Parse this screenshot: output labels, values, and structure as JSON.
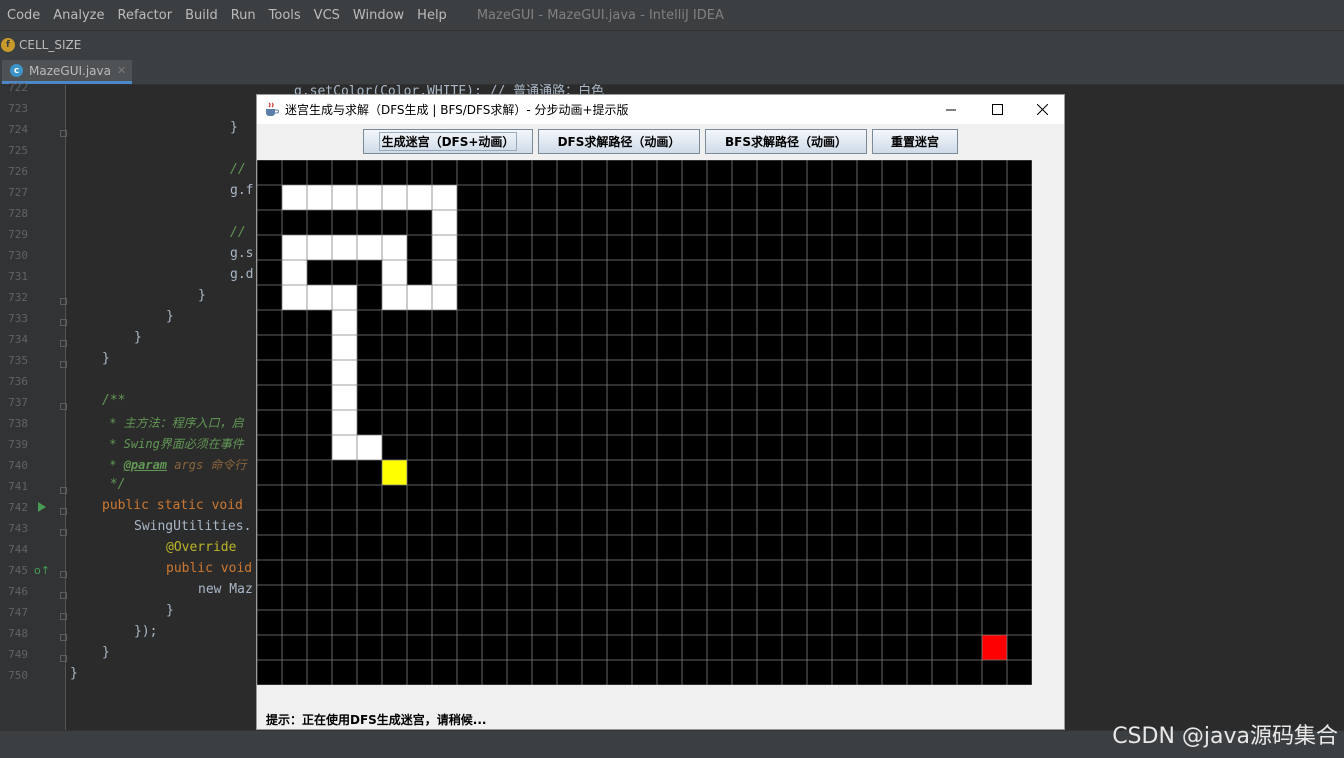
{
  "ide": {
    "menu": [
      "Code",
      "Analyze",
      "Refactor",
      "Build",
      "Run",
      "Tools",
      "VCS",
      "Window",
      "Help"
    ],
    "title": "MazeGUI - MazeGUI.java - IntelliJ IDEA",
    "breadcrumb": "CELL_SIZE",
    "tab_label": "MazeGUI.java",
    "line_numbers": [
      "722",
      "723",
      "724",
      "725",
      "726",
      "727",
      "728",
      "729",
      "730",
      "731",
      "732",
      "733",
      "734",
      "735",
      "736",
      "737",
      "738",
      "739",
      "740",
      "741",
      "742",
      "743",
      "744",
      "745",
      "746",
      "747",
      "748",
      "749",
      "750"
    ],
    "code_fragments": {
      "l722": "g.setColor(Color.WHITE); // 普通通路：白色",
      "l724": "}",
      "l726": "// ",
      "l727": "g.f",
      "l729": "// ",
      "l730": "g.s",
      "l731": "g.d",
      "l732": "}",
      "l733": "}",
      "l734": "}",
      "l735": "}",
      "l737": "/**",
      "l738": " * 主方法：程序入口，启",
      "l739": " * Swing界面必须在事件",
      "l740_tag": "@param",
      "l740_rest": " args 命令行",
      "l741": " */",
      "l742": "public static void",
      "l743": "SwingUtilities.",
      "l744": "@Override",
      "l745": "public void",
      "l746": "new Maz",
      "l747": "}",
      "l748": "});",
      "l749": "}",
      "l750": "}"
    },
    "watermark": "CSDN @java源码集合"
  },
  "window": {
    "title": "迷宫生成与求解（DFS生成 | BFS/DFS求解）- 分步动画+提示版",
    "buttons": {
      "generate": "生成迷宫（DFS+动画）",
      "dfs_solve": "DFS求解路径（动画）",
      "bfs_solve": "BFS求解路径（动画）",
      "reset": "重置迷宫"
    },
    "hint": "提示：正在使用DFS生成迷宫，请稍候..."
  },
  "maze": {
    "cols": 31,
    "rows": 21,
    "colors": {
      "wall": "#000000",
      "path": "#ffffff",
      "current": "#ffff00",
      "end": "#ff0000",
      "grid": "#808080"
    },
    "path_cells": [
      [
        1,
        1
      ],
      [
        2,
        1
      ],
      [
        3,
        1
      ],
      [
        4,
        1
      ],
      [
        5,
        1
      ],
      [
        6,
        1
      ],
      [
        7,
        1
      ],
      [
        7,
        2
      ],
      [
        1,
        3
      ],
      [
        2,
        3
      ],
      [
        3,
        3
      ],
      [
        4,
        3
      ],
      [
        5,
        3
      ],
      [
        7,
        3
      ],
      [
        1,
        4
      ],
      [
        5,
        4
      ],
      [
        7,
        4
      ],
      [
        1,
        5
      ],
      [
        2,
        5
      ],
      [
        3,
        5
      ],
      [
        5,
        5
      ],
      [
        6,
        5
      ],
      [
        7,
        5
      ],
      [
        3,
        6
      ],
      [
        3,
        7
      ],
      [
        3,
        8
      ],
      [
        3,
        9
      ],
      [
        3,
        10
      ],
      [
        3,
        11
      ],
      [
        4,
        11
      ]
    ],
    "current_cell": [
      5,
      12
    ],
    "end_cell": [
      29,
      19
    ]
  }
}
